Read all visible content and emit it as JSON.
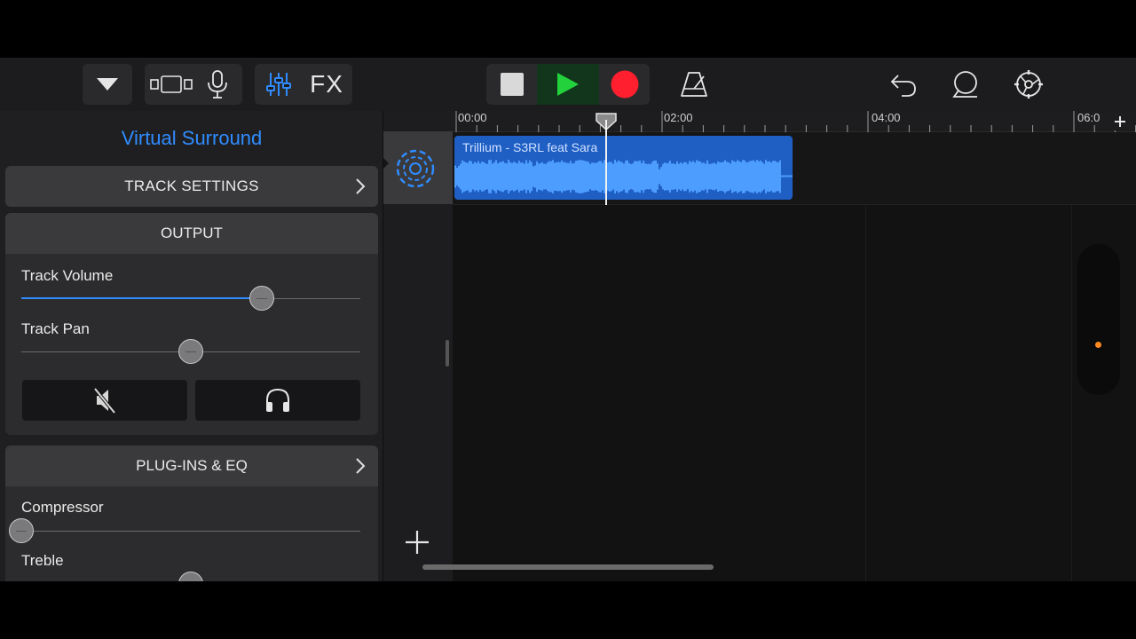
{
  "toolbar": {
    "fx_label": "FX",
    "accent_color": "#2f8cff",
    "play_color": "#22d13b",
    "record_color": "#ff1f2e"
  },
  "panel": {
    "title": "Virtual Surround",
    "track_settings_label": "TRACK SETTINGS",
    "output": {
      "header": "OUTPUT",
      "track_volume_label": "Track Volume",
      "track_volume_value": 0.71,
      "track_pan_label": "Track Pan",
      "track_pan_value": 0.5
    },
    "plugins": {
      "header": "PLUG-INS & EQ",
      "compressor_label": "Compressor",
      "compressor_value": 0.0,
      "treble_label": "Treble",
      "treble_value": 0.5
    }
  },
  "timeline": {
    "ruler_labels": [
      "00:00",
      "02:00",
      "04:00",
      "06:0"
    ],
    "region_name": "Trillium - S3RL feat Sara",
    "region_color": "#1f5fc4",
    "wave_color": "#4d9dff"
  },
  "icons": {
    "dropdown": "triangle-down-icon",
    "tracks_view": "tracks-view-icon",
    "mic": "microphone-icon",
    "mixer": "mixer-sliders-icon",
    "stop": "stop-icon",
    "play": "play-icon",
    "record": "record-icon",
    "metronome": "metronome-icon",
    "undo": "undo-icon",
    "loop": "loop-browser-icon",
    "settings": "gear-icon",
    "mute": "mute-icon",
    "solo": "headphones-icon",
    "add": "plus-icon"
  }
}
